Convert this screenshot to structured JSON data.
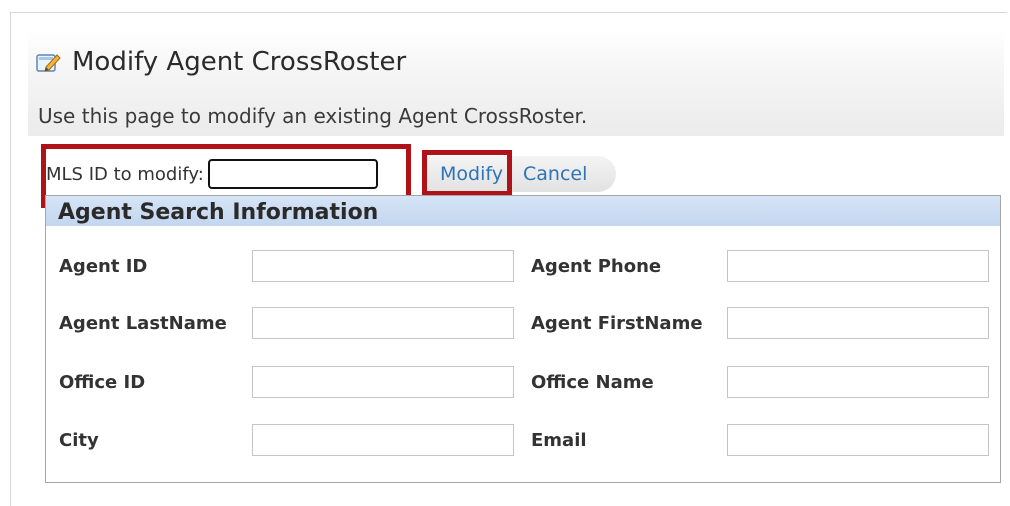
{
  "page": {
    "title": "Modify Agent CrossRoster",
    "description": "Use this page to modify an existing Agent CrossRoster.",
    "title_icon": "edit-pencil-icon"
  },
  "mls": {
    "label": "MLS ID to modify:",
    "value": ""
  },
  "actions": {
    "modify_label": "Modify",
    "cancel_label": "Cancel"
  },
  "search": {
    "header": "Agent Search Information",
    "fields": {
      "agent_id": {
        "label": "Agent ID",
        "value": ""
      },
      "agent_phone": {
        "label": "Agent Phone",
        "value": ""
      },
      "agent_lastname": {
        "label": "Agent LastName",
        "value": ""
      },
      "agent_firstname": {
        "label": "Agent FirstName",
        "value": ""
      },
      "office_id": {
        "label": "Office ID",
        "value": ""
      },
      "office_name": {
        "label": "Office Name",
        "value": ""
      },
      "city": {
        "label": "City",
        "value": ""
      },
      "email": {
        "label": "Email",
        "value": ""
      }
    }
  },
  "colors": {
    "highlight": "#b0121a",
    "link": "#2e73b8",
    "section_header": "#c9daf1"
  }
}
